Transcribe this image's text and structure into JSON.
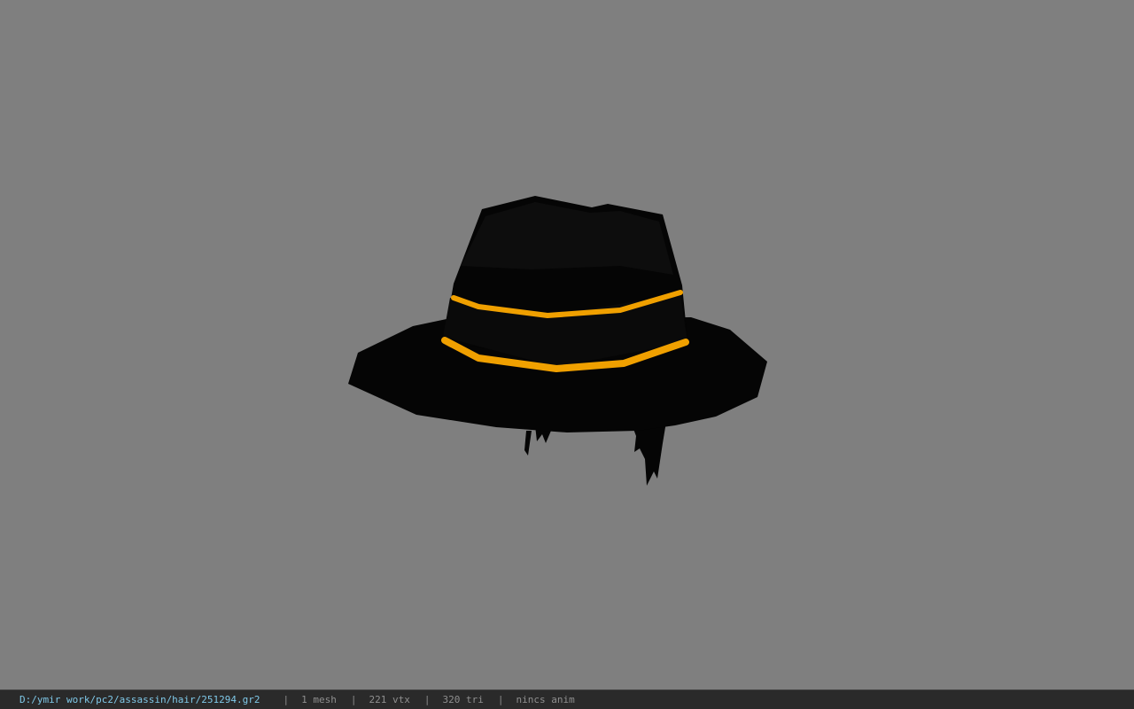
{
  "viewer": {
    "background_color": "#7f7f7f",
    "model": {
      "icon": "hat-model",
      "hat_color": "#050505",
      "band_color": "#f0a000"
    }
  },
  "status_bar": {
    "file_path": "D:/ymir work/pc2/assassin/hair/251294.gr2",
    "separator": "|",
    "mesh_count": "1 mesh",
    "vertex_count": "221 vtx",
    "triangle_count": "320 tri",
    "animation": "nincs anim"
  }
}
